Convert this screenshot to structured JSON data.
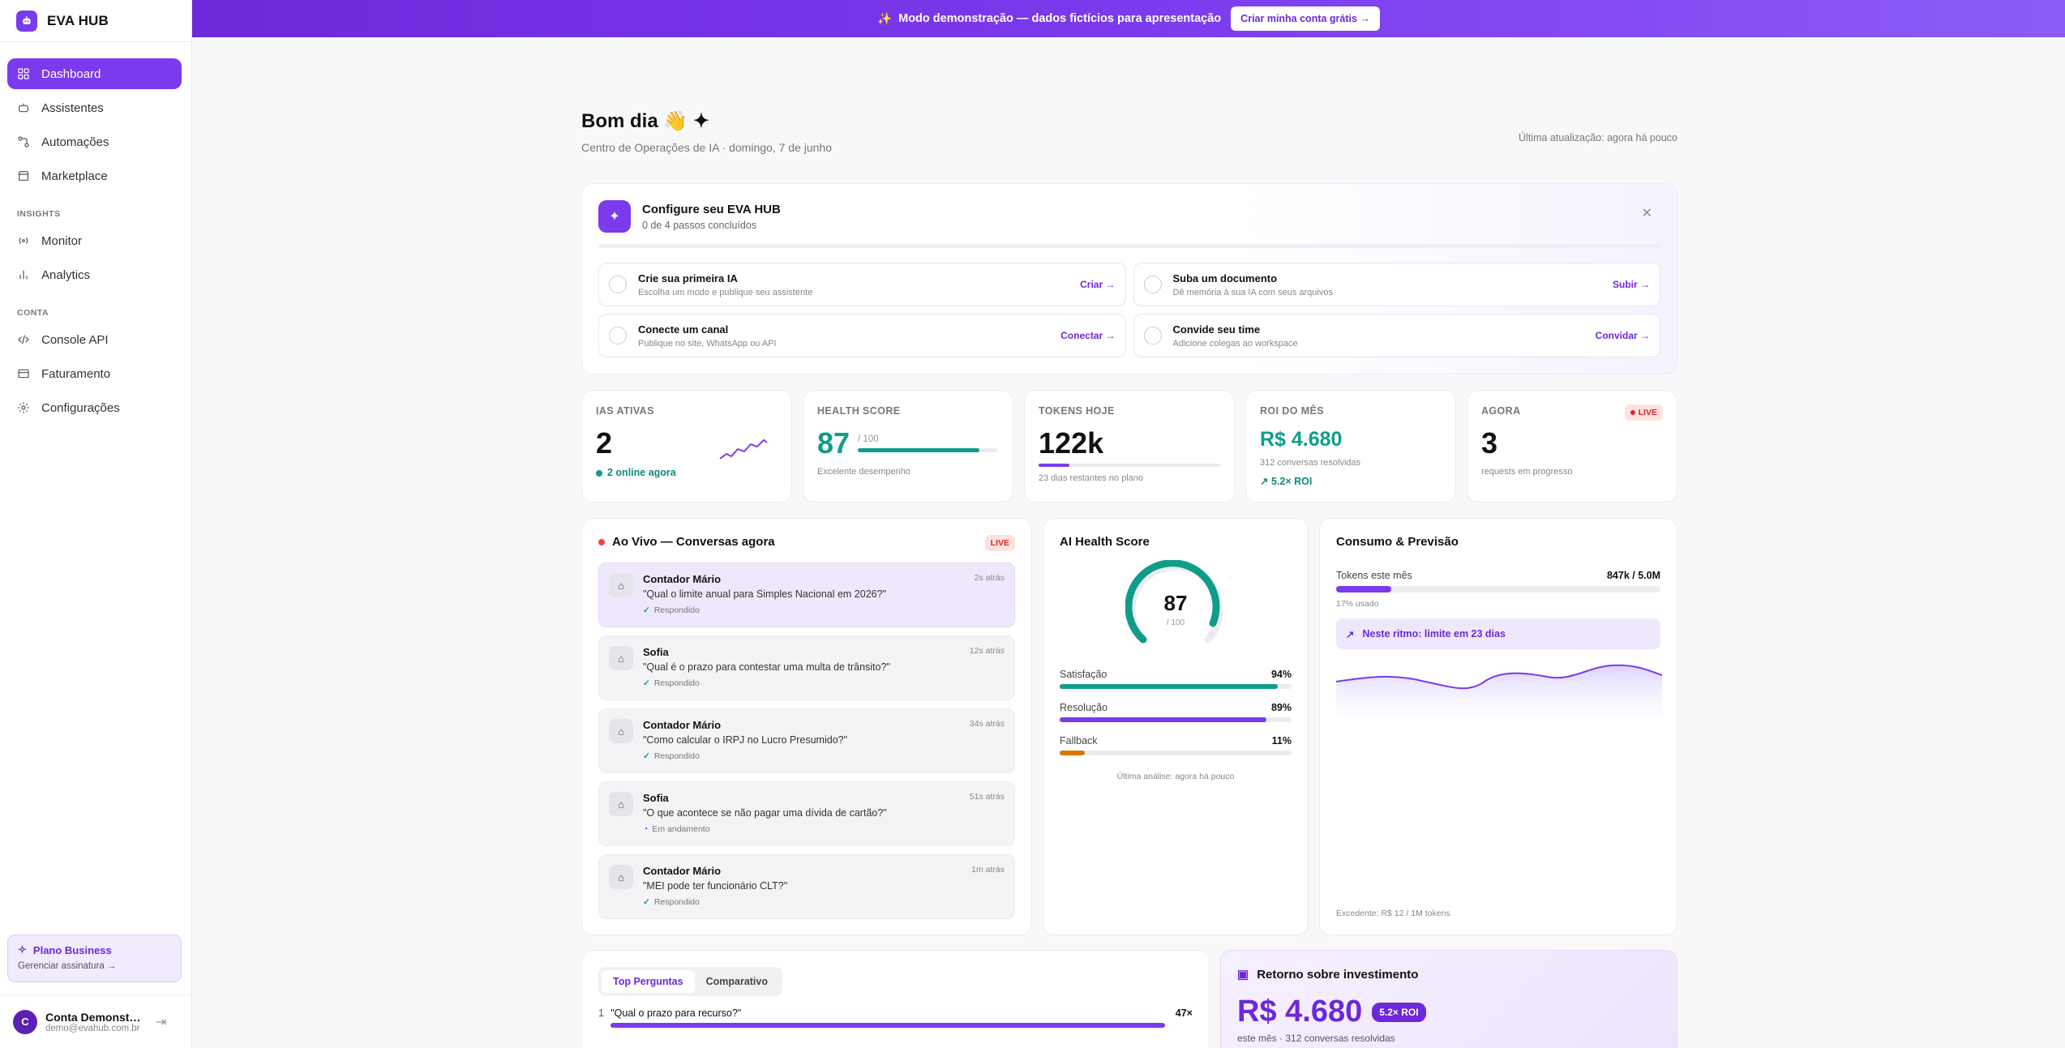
{
  "app": {
    "name": "EVA HUB"
  },
  "banner": {
    "text": "Modo demonstração — dados fictícios para apresentação",
    "cta": "Criar minha conta grátis →"
  },
  "sidebar": {
    "main": [
      {
        "label": "Dashboard",
        "icon": "grid-icon",
        "active": true
      },
      {
        "label": "Assistentes",
        "icon": "bot-icon"
      },
      {
        "label": "Automações",
        "icon": "workflow-icon"
      },
      {
        "label": "Marketplace",
        "icon": "store-icon"
      }
    ],
    "insights_heading": "INSIGHTS",
    "insights": [
      {
        "label": "Monitor",
        "icon": "radio-icon"
      },
      {
        "label": "Analytics",
        "icon": "bar-chart-icon"
      }
    ],
    "conta_heading": "CONTA",
    "conta": [
      {
        "label": "Console API",
        "icon": "code-icon"
      },
      {
        "label": "Faturamento",
        "icon": "credit-card-icon"
      },
      {
        "label": "Configurações",
        "icon": "gear-icon"
      }
    ],
    "plan": {
      "title": "Plano Business",
      "sub": "Gerenciar assinatura →"
    },
    "account": {
      "initial": "C",
      "name": "Conta Demonstração",
      "email": "demo@evahub.com.br"
    }
  },
  "header": {
    "greeting": "Bom dia 👋 ✦",
    "subtitle": "Centro de Operações de IA · domingo, 7 de junho",
    "updated": "Última atualização: agora há pouco"
  },
  "setup": {
    "title": "Configure seu EVA HUB",
    "count": "0 de 4 passos concluídos",
    "progress": 0,
    "steps": [
      {
        "title": "Crie sua primeira IA",
        "desc": "Escolha um modo e publique seu assistente",
        "action": "Criar →"
      },
      {
        "title": "Suba um documento",
        "desc": "Dê memória à sua IA com seus arquivos",
        "action": "Subir →"
      },
      {
        "title": "Conecte um canal",
        "desc": "Publique no site, WhatsApp ou API",
        "action": "Conectar →"
      },
      {
        "title": "Convide seu time",
        "desc": "Adicione colegas ao workspace",
        "action": "Convidar →"
      }
    ]
  },
  "kpis": {
    "ias": {
      "label": "IAS ATIVAS",
      "value": "2",
      "foot": "2 online agora"
    },
    "health": {
      "label": "HEALTH SCORE",
      "value": "87",
      "of": "/ 100",
      "foot": "Excelente desempenho",
      "fraction": 0.87
    },
    "tokens": {
      "label": "TOKENS HOJE",
      "value": "122k",
      "foot": "23 dias restantes no plano"
    },
    "roi": {
      "label": "ROI DO MÊS",
      "value": "R$ 4.680",
      "foot": "312 conversas resolvidas",
      "trend": "↗ 5.2× ROI"
    },
    "agora": {
      "label": "AGORA",
      "badge": "LIVE",
      "value": "3",
      "foot": "requests em progresso"
    }
  },
  "live": {
    "title": "Ao Vivo — Conversas agora",
    "badge": "LIVE",
    "items": [
      {
        "name": "Contador Mário",
        "q": "\"Qual o limite anual para Simples Nacional em 2026?\"",
        "status": "Respondido",
        "time": "2s atrás",
        "done": true
      },
      {
        "name": "Sofia",
        "q": "\"Qual é o prazo para contestar uma multa de trânsito?\"",
        "status": "Respondido",
        "time": "12s atrás",
        "done": true
      },
      {
        "name": "Contador Mário",
        "q": "\"Como calcular o IRPJ no Lucro Presumido?\"",
        "status": "Respondido",
        "time": "34s atrás",
        "done": true
      },
      {
        "name": "Sofia",
        "q": "\"O que acontece se não pagar uma dívida de cartão?\"",
        "status": "Em andamento",
        "time": "51s atrás",
        "done": false
      },
      {
        "name": "Contador Mário",
        "q": "\"MEI pode ter funcionário CLT?\"",
        "status": "Respondido",
        "time": "1m atrás",
        "done": true
      }
    ]
  },
  "ai_health": {
    "title": "AI Health Score",
    "score": "87",
    "of": "/ 100",
    "metrics": [
      {
        "label": "Satisfação",
        "value": "94%",
        "fraction": 0.94,
        "color": "#0f9d8a"
      },
      {
        "label": "Resolução",
        "value": "89%",
        "fraction": 0.89,
        "color": "#7c3aed"
      },
      {
        "label": "Fallback",
        "value": "11%",
        "fraction": 0.11,
        "color": "#d97706"
      }
    ],
    "foot": "Última análise: agora há pouco"
  },
  "usage": {
    "title": "Consumo & Previsão",
    "label": "Tokens este mês",
    "value": "847k / 5.0M",
    "fraction": 0.17,
    "used": "17% usado",
    "pace": "Neste ritmo: limite em 23 dias",
    "foot": "Excedente: R$ 12 / 1M tokens"
  },
  "top_questions": {
    "tabs": [
      "Top Perguntas",
      "Comparativo"
    ],
    "items": [
      {
        "rank": "1",
        "q": "\"Qual o prazo para recurso?\"",
        "count": "47×"
      }
    ]
  },
  "roi_card": {
    "title": "Retorno sobre investimento",
    "value": "R$ 4.680",
    "badge": "5.2× ROI",
    "sub": "este mês · 312 conversas resolvidas"
  }
}
